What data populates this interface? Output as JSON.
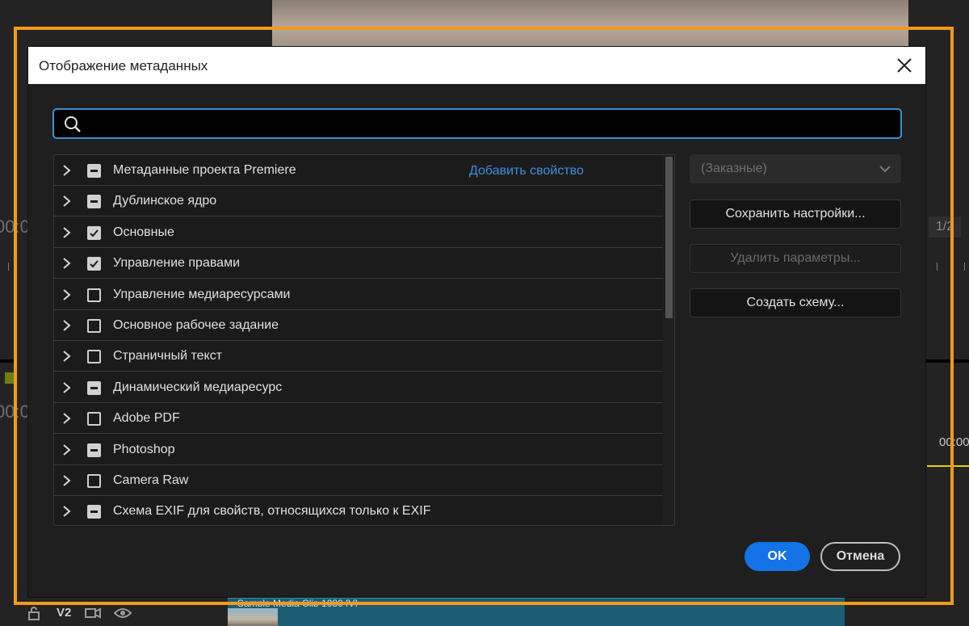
{
  "background": {
    "track_label": "V2",
    "clip_label": "Sample Media Clip 1080 [V]",
    "timecode_left": "00:0",
    "timecode_left2": "00:0",
    "timecode_right": "00:00",
    "page_indicator": "1/2"
  },
  "dialog": {
    "title": "Отображение метаданных",
    "search": {
      "value": "",
      "placeholder": ""
    },
    "add_property_label": "Добавить свойство",
    "rows": [
      {
        "label": "Метаданные проекта Premiere",
        "state": "mixed"
      },
      {
        "label": "Дублинское ядро",
        "state": "mixed"
      },
      {
        "label": "Основные",
        "state": "checked"
      },
      {
        "label": "Управление правами",
        "state": "checked"
      },
      {
        "label": "Управление медиаресурсами",
        "state": "unchecked"
      },
      {
        "label": "Основное рабочее задание",
        "state": "unchecked"
      },
      {
        "label": "Страничный текст",
        "state": "unchecked"
      },
      {
        "label": "Динамический медиаресурс",
        "state": "mixed"
      },
      {
        "label": "Adobe PDF",
        "state": "unchecked"
      },
      {
        "label": "Photoshop",
        "state": "mixed"
      },
      {
        "label": "Camera Raw",
        "state": "unchecked"
      },
      {
        "label": "Схема EXIF для свойств, относящихся только к EXIF",
        "state": "mixed"
      }
    ],
    "preset_select": {
      "value": "(Заказные)"
    },
    "save_settings_label": "Сохранить настройки...",
    "delete_params_label": "Удалить параметры...",
    "create_schema_label": "Создать схему...",
    "ok_label": "OK",
    "cancel_label": "Отмена"
  },
  "colors": {
    "accent": "#1473e6",
    "frame_highlight": "#f39a1c",
    "link": "#3d8fe0",
    "search_focus": "#3d8fd6"
  }
}
